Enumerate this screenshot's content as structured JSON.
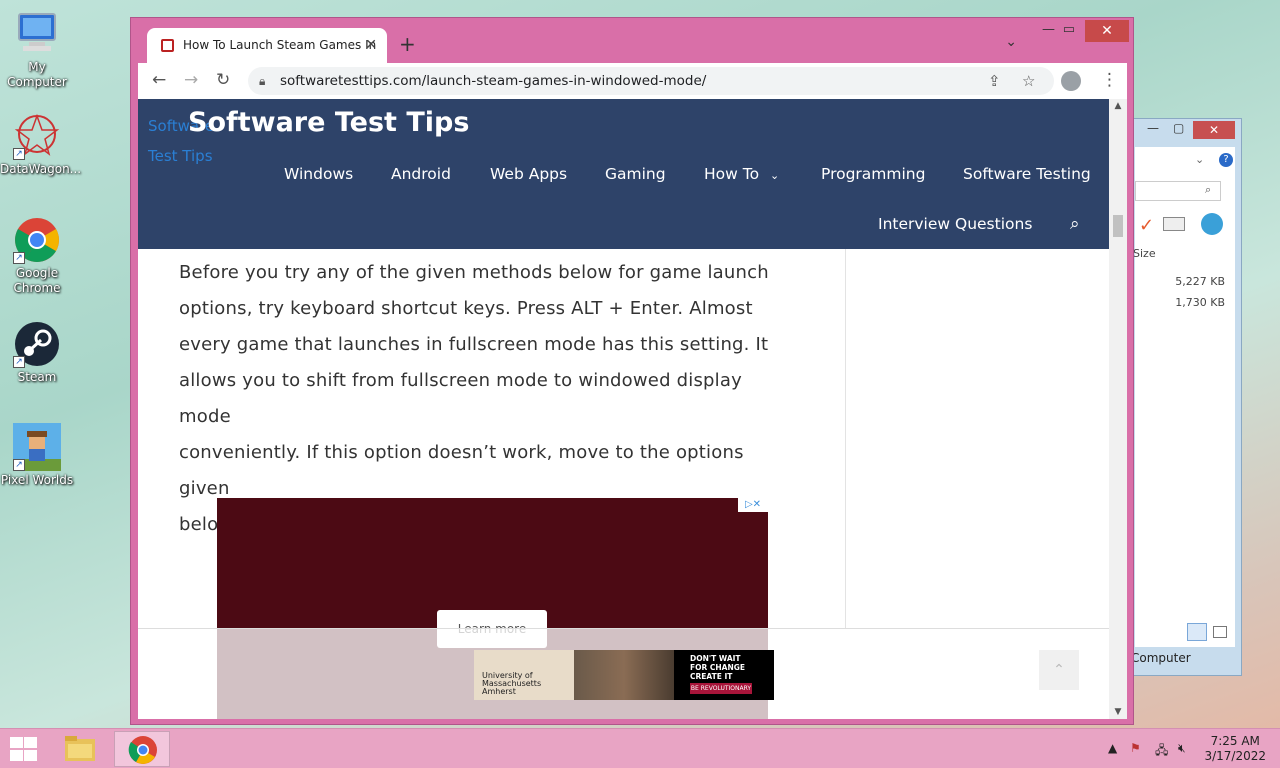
{
  "desktop": {
    "icons": [
      {
        "label": "My Computer"
      },
      {
        "label": "DataWagon..."
      },
      {
        "label": "Google Chrome"
      },
      {
        "label": "Steam"
      },
      {
        "label": "Pixel Worlds"
      }
    ]
  },
  "explorer": {
    "size_header": "Size",
    "rows": [
      "5,227 KB",
      "1,730 KB"
    ],
    "status": "Computer"
  },
  "browser": {
    "tab_title": "How To Launch Steam Games In",
    "url": "softwaretesttips.com/launch-steam-games-in-windowed-mode/"
  },
  "site": {
    "logo_alt": "Software Test Tips",
    "title": "Software Test Tips",
    "nav": [
      "Windows",
      "Android",
      "Web Apps",
      "Gaming",
      "How To",
      "Programming",
      "Software Testing",
      "Interview Questions"
    ],
    "paragraph_lines": [
      "Before you try any of the given methods below for game launch",
      "options, try keyboard shortcut keys. Press ALT + Enter. Almost",
      "every game that launches in fullscreen mode has this setting. It",
      "allows you to shift from fullscreen mode to windowed display mode",
      "conveniently. If this option doesn’t work, move to the options given",
      "below:"
    ],
    "ad_button": "Learn more",
    "banner": {
      "university": "University of Massachusetts Amherst",
      "headline": "DON'T WAIT FOR CHANGE CREATE IT",
      "cta": "BE REVOLUTIONARY"
    }
  },
  "taskbar": {
    "time": "7:25 AM",
    "date": "3/17/2022"
  },
  "colors": {
    "site_header": "#2e4369",
    "window_frame": "#d96fa8",
    "taskbar": "#e8a4c4",
    "ad_bg": "#4c0a14"
  }
}
